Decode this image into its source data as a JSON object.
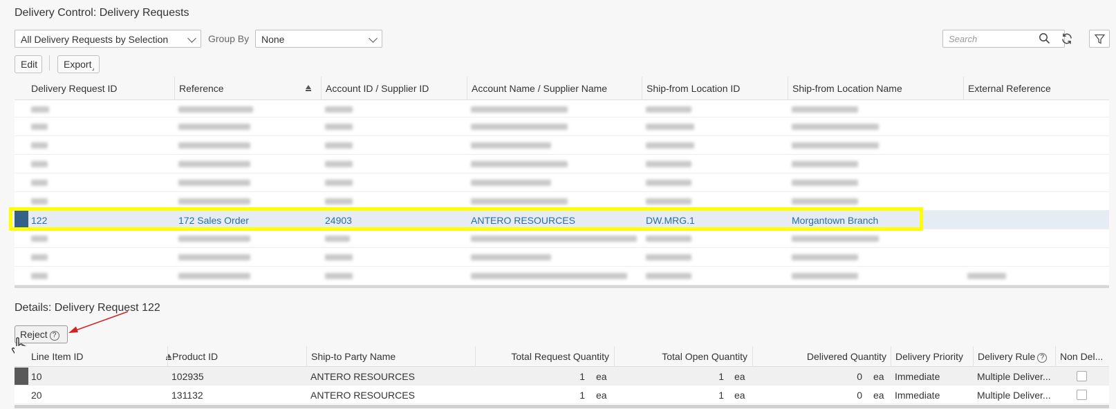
{
  "page": {
    "title": "Delivery Control: Delivery Requests"
  },
  "filters": {
    "variant": "All Delivery Requests by Selection",
    "group_by_label": "Group By",
    "group_by_value": "None",
    "search_placeholder": "Search"
  },
  "toolbar": {
    "edit_label": "Edit",
    "export_label": "Export"
  },
  "requests_table": {
    "columns": [
      "Delivery Request ID",
      "Reference",
      "Account ID / Supplier ID",
      "Account Name / Supplier Name",
      "Ship-from Location ID",
      "Ship-from Location Name",
      "External Reference"
    ],
    "selected_row": {
      "id": "122",
      "reference": "172 Sales Order",
      "account_id": "24903",
      "account_name": "ANTERO RESOURCES",
      "ship_from_id": "DW.MRG.1",
      "ship_from_name": "Morgantown Branch",
      "external_reference": ""
    }
  },
  "details": {
    "title": "Details: Delivery Request 122",
    "reject_label": "Reject",
    "columns": [
      "Line Item ID",
      "Product ID",
      "Ship-to Party Name",
      "Total Request Quantity",
      "Total Open Quantity",
      "Delivered Quantity",
      "Delivery Priority",
      "Delivery Rule",
      "Non Del..."
    ],
    "rows": [
      {
        "line_item": "10",
        "product": "102935",
        "ship_to": "ANTERO RESOURCES",
        "total_req": "1",
        "total_req_unit": "ea",
        "open_qty": "1",
        "open_unit": "ea",
        "delivered": "0",
        "delivered_unit": "ea",
        "priority": "Immediate",
        "rule": "Multiple Deliver..."
      },
      {
        "line_item": "20",
        "product": "131132",
        "ship_to": "ANTERO RESOURCES",
        "total_req": "1",
        "total_req_unit": "ea",
        "open_qty": "1",
        "open_unit": "ea",
        "delivered": "0",
        "delivered_unit": "ea",
        "priority": "Immediate",
        "rule": "Multiple Deliver..."
      }
    ]
  },
  "colors": {
    "highlight": "#ffff00",
    "selection_marker": "#346187",
    "link_text": "#2a6cab",
    "annotation_arrow": "#d62020"
  }
}
